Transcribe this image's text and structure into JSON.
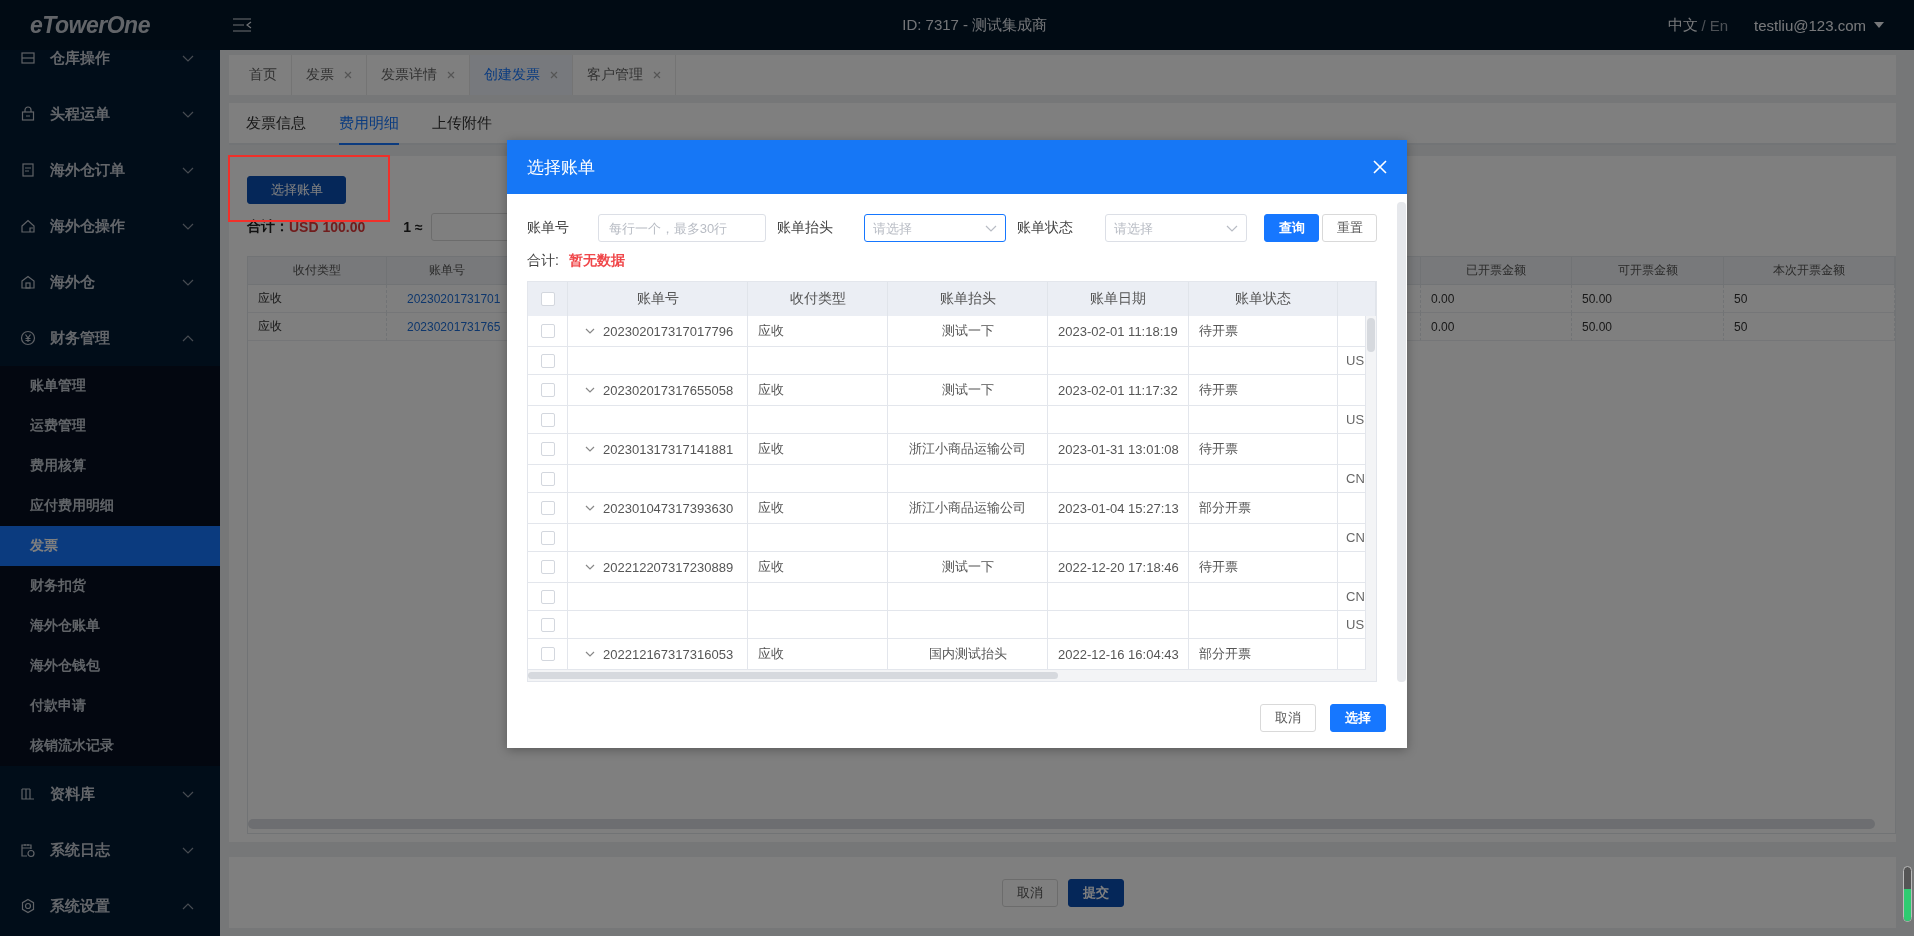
{
  "header": {
    "logo": "eTowerOne",
    "title": "ID: 7317 - 测试集成商",
    "languages": [
      {
        "label": "中文",
        "selected": true
      },
      {
        "label": "En",
        "selected": false
      }
    ],
    "language_separator": "/",
    "user": "testliu@123.com"
  },
  "sidebar": {
    "items": [
      {
        "label": "仓库操作",
        "expanded": false
      },
      {
        "label": "头程运单",
        "expanded": false
      },
      {
        "label": "海外仓订单",
        "expanded": false
      },
      {
        "label": "海外仓操作",
        "expanded": false
      },
      {
        "label": "海外仓",
        "expanded": false
      },
      {
        "label": "财务管理",
        "expanded": true,
        "children": [
          {
            "label": "账单管理",
            "selected": false
          },
          {
            "label": "运费管理",
            "selected": false
          },
          {
            "label": "费用核算",
            "selected": false
          },
          {
            "label": "应付费用明细",
            "selected": false
          },
          {
            "label": "发票",
            "selected": true
          },
          {
            "label": "财务扣货",
            "selected": false
          },
          {
            "label": "海外仓账单",
            "selected": false
          },
          {
            "label": "海外仓钱包",
            "selected": false
          },
          {
            "label": "付款申请",
            "selected": false
          },
          {
            "label": "核销流水记录",
            "selected": false
          }
        ]
      },
      {
        "label": "资料库",
        "expanded": false
      },
      {
        "label": "系统日志",
        "expanded": false
      },
      {
        "label": "系统设置",
        "expanded": true
      }
    ]
  },
  "tabs": [
    {
      "label": "首页",
      "selected": false,
      "closable": false
    },
    {
      "label": "发票",
      "selected": false,
      "closable": true
    },
    {
      "label": "发票详情",
      "selected": false,
      "closable": true
    },
    {
      "label": "创建发票",
      "selected": true,
      "closable": true
    },
    {
      "label": "客户管理",
      "selected": false,
      "closable": true
    }
  ],
  "sub_tabs": [
    {
      "label": "发票信息",
      "selected": false
    },
    {
      "label": "费用明细",
      "selected": true
    },
    {
      "label": "上传附件",
      "selected": false
    }
  ],
  "content": {
    "select_button": "选择账单",
    "total_label": "合计：",
    "total_value": "USD 100.00",
    "rate_label": "1 ≈",
    "table": {
      "columns": [
        "收付类型",
        "账单号",
        "已开票金额",
        "可开票金额",
        "本次开票金额"
      ],
      "rows": [
        [
          "应收",
          "20230201731701",
          "0.00",
          "50.00",
          "50"
        ],
        [
          "应收",
          "20230201731765",
          "0.00",
          "50.00",
          "50"
        ]
      ]
    }
  },
  "footer_buttons": [
    {
      "label": "取消",
      "kind": "default"
    },
    {
      "label": "提交",
      "kind": "primary"
    }
  ],
  "modal": {
    "title": "选择账单",
    "filters": [
      {
        "label": "账单号",
        "kind": "input",
        "placeholder": "每行一个，最多30行",
        "focused": false
      },
      {
        "label": "账单抬头",
        "kind": "select",
        "placeholder": "请选择",
        "focused": true
      },
      {
        "label": "账单状态",
        "kind": "select",
        "placeholder": "请选择",
        "focused": false
      }
    ],
    "filter_buttons": [
      {
        "label": "查询",
        "kind": "primary"
      },
      {
        "label": "重置",
        "kind": "default"
      }
    ],
    "total_label": "合计:",
    "total_value": "暂无数据",
    "table": {
      "all_checked": false,
      "columns": [
        "账单号",
        "收付类型",
        "账单抬头",
        "账单日期",
        "账单状态"
      ],
      "rows": [
        {
          "kind": "bill",
          "checked": false,
          "bill_no": "202302017317017796",
          "type": "应收",
          "payer": "测试一下",
          "date": "2023-02-01 11:18:19",
          "status": "待开票"
        },
        {
          "kind": "currency",
          "checked": false,
          "currency": "US"
        },
        {
          "kind": "bill",
          "checked": false,
          "bill_no": "202302017317655058",
          "type": "应收",
          "payer": "测试一下",
          "date": "2023-02-01 11:17:32",
          "status": "待开票"
        },
        {
          "kind": "currency",
          "checked": false,
          "currency": "US"
        },
        {
          "kind": "bill",
          "checked": false,
          "bill_no": "202301317317141881",
          "type": "应收",
          "payer": "浙江小商品运输公司",
          "date": "2023-01-31 13:01:08",
          "status": "待开票"
        },
        {
          "kind": "currency",
          "checked": false,
          "currency": "CN"
        },
        {
          "kind": "bill",
          "checked": false,
          "bill_no": "202301047317393630",
          "type": "应收",
          "payer": "浙江小商品运输公司",
          "date": "2023-01-04 15:27:13",
          "status": "部分开票"
        },
        {
          "kind": "currency",
          "checked": false,
          "currency": "CN"
        },
        {
          "kind": "bill",
          "checked": false,
          "bill_no": "202212207317230889",
          "type": "应收",
          "payer": "测试一下",
          "date": "2022-12-20 17:18:46",
          "status": "待开票"
        },
        {
          "kind": "currency",
          "checked": false,
          "currency": "CN"
        },
        {
          "kind": "currency",
          "checked": false,
          "currency": "US"
        },
        {
          "kind": "bill",
          "checked": false,
          "bill_no": "202212167317316053",
          "type": "应收",
          "payer": "国内测试抬头",
          "date": "2022-12-16 16:04:43",
          "status": "部分开票"
        }
      ]
    },
    "footer_buttons": [
      {
        "label": "取消",
        "kind": "default"
      },
      {
        "label": "选择",
        "kind": "primary"
      }
    ]
  }
}
